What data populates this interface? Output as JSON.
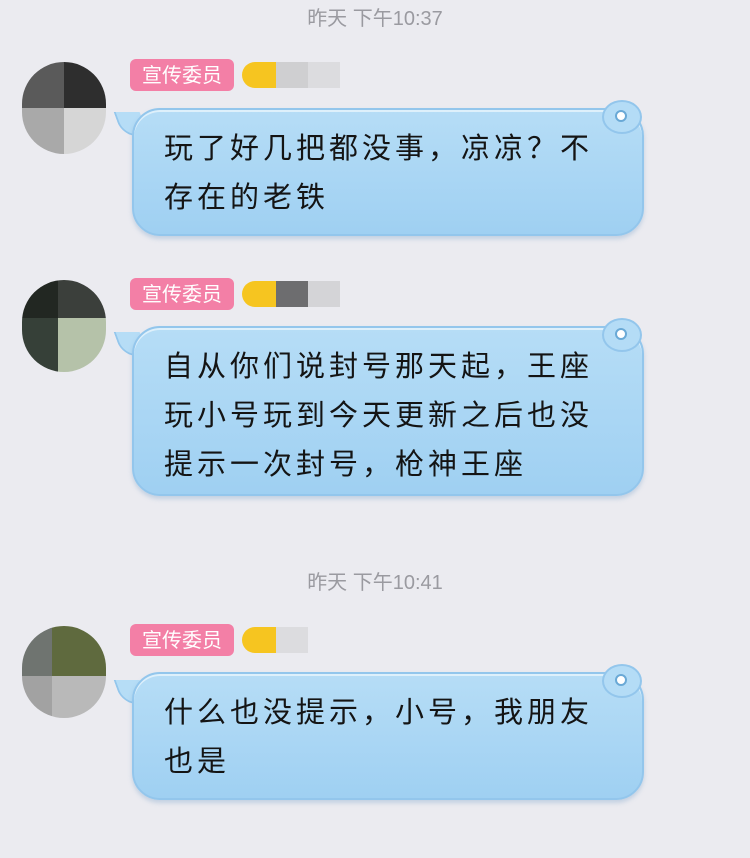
{
  "timestamps": [
    "昨天  下午10:37",
    "昨天  下午10:41"
  ],
  "messages": [
    {
      "badge": "宣传委员",
      "text": "玩了好几把都没事，凉凉？不存在的老铁",
      "level_colors": [
        "#cfcfd1",
        "#dcdcdf"
      ]
    },
    {
      "badge": "宣传委员",
      "text": "自从你们说封号那天起，王座玩小号玩到今天更新之后也没提示一次封号，枪神王座",
      "level_colors": [
        "#6d6d6f",
        "#d4d4d7"
      ]
    },
    {
      "badge": "宣传委员",
      "text": "什么也没提示，小号，我朋友也是",
      "level_colors": [
        "#dcdcdf"
      ]
    }
  ],
  "avatar_colors": [
    [
      "#5a5a5a",
      "#2e2e2e",
      "#a9a9a9",
      "#d6d6d6"
    ],
    [
      "#222722",
      "#3b3f3b",
      "#364038",
      "#b5c2a9"
    ],
    [
      "#6f7470",
      "#5f6a3e",
      "#a2a2a2",
      "#b9b9b9"
    ]
  ]
}
